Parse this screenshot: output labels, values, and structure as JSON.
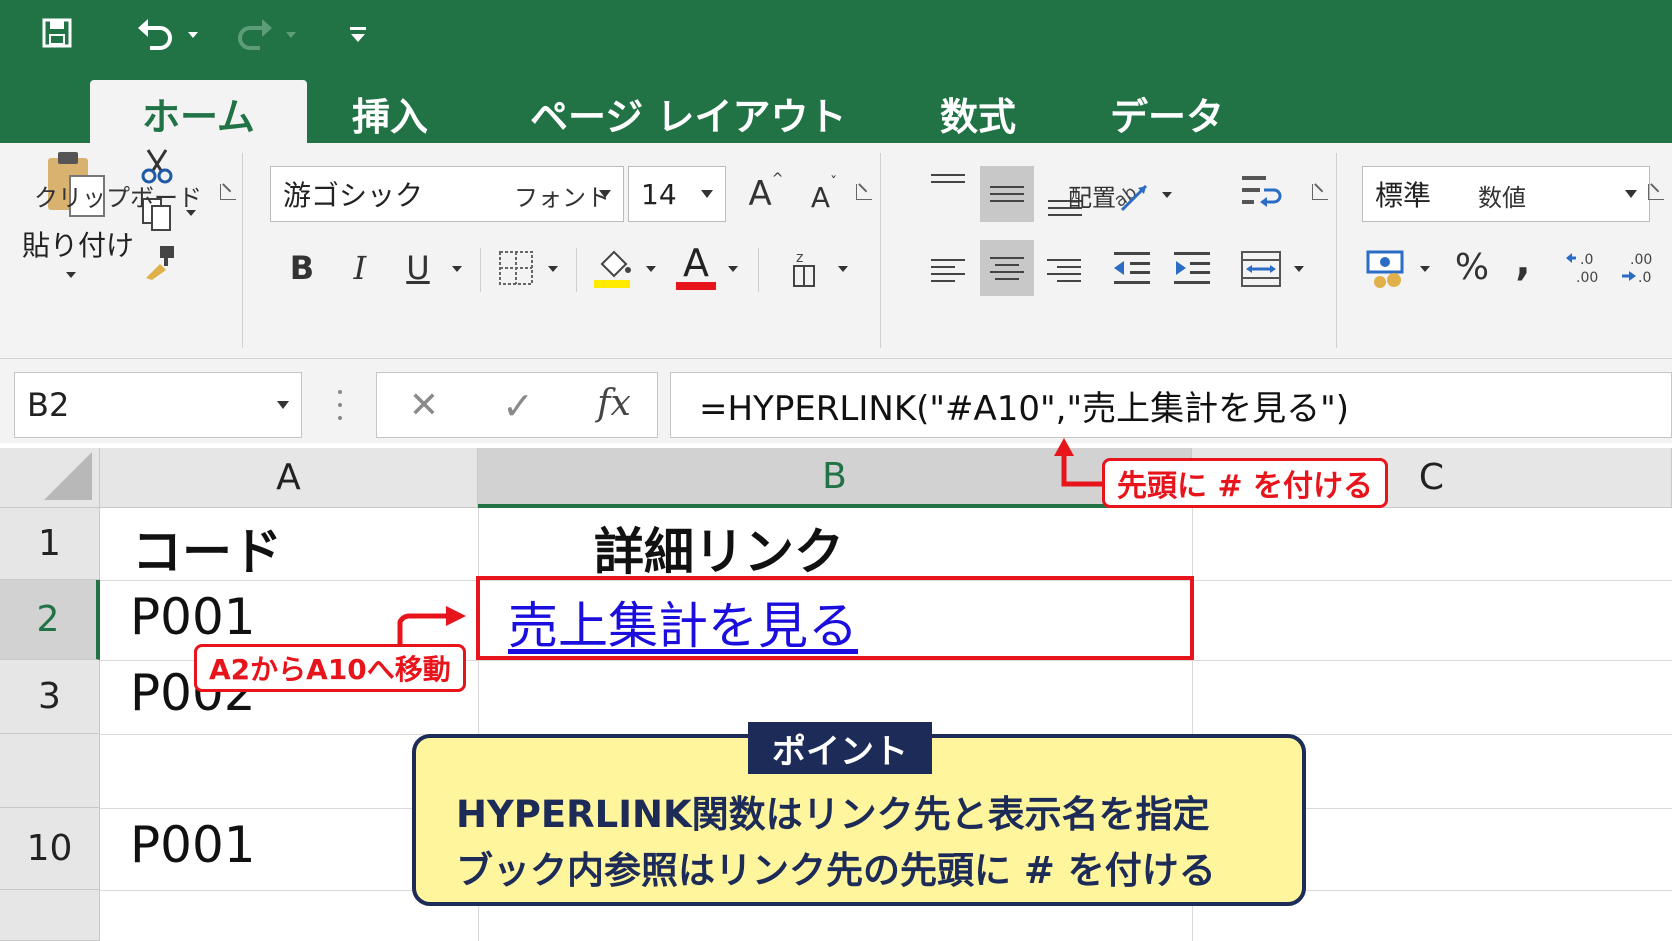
{
  "ribbon_tabs": [
    {
      "label": "ホーム",
      "active": true
    },
    {
      "label": "挿入"
    },
    {
      "label": "ページ レイアウト"
    },
    {
      "label": "数式"
    },
    {
      "label": "データ"
    }
  ],
  "quick_access": {
    "save_icon": "save-icon",
    "undo_icon": "undo-icon",
    "redo_icon": "redo-icon",
    "customize_icon": "customize-qat-icon"
  },
  "clipboard": {
    "paste_label": "貼り付け",
    "group_label": "クリップボード"
  },
  "font": {
    "font_name": "游ゴシック",
    "font_size": "14",
    "increase_glyph": "A",
    "decrease_glyph": "A",
    "bold_glyph": "B",
    "italic_glyph": "I",
    "underline_glyph": "U",
    "font_color_glyph": "A",
    "group_label": "フォント"
  },
  "alignment": {
    "group_label": "配置"
  },
  "number": {
    "format": "標準",
    "percent_glyph": "%",
    "comma_glyph": ",",
    "group_label": "数値"
  },
  "formula_bar": {
    "name_box": "B2",
    "cancel_glyph": "✕",
    "enter_glyph": "✓",
    "fx_glyph": "fx",
    "formula": "=HYPERLINK(\"#A10\",\"売上集計を見る\")"
  },
  "columns": [
    "A",
    "B",
    "C"
  ],
  "rows": [
    {
      "row": "1",
      "a": "コード",
      "b": "詳細リンク"
    },
    {
      "row": "2",
      "a": "P001",
      "b": "売上集計を見る"
    },
    {
      "row": "3",
      "a": "P002",
      "b": ""
    },
    {
      "row": "10",
      "a": "P001",
      "b": ""
    }
  ],
  "callouts": {
    "hash_note": "先頭に # を付ける",
    "jump_note": "A2からA10へ移動"
  },
  "point": {
    "title": "ポイント",
    "line1": "HYPERLINK関数はリンク先と表示名を指定",
    "line2": "ブック内参照はリンク先の先頭に # を付ける"
  },
  "colors": {
    "excel_green": "#217346",
    "link_blue": "#1a0dde",
    "callout_red": "#e8141c",
    "point_navy": "#1c2b57",
    "point_yellow": "#fff59d"
  }
}
